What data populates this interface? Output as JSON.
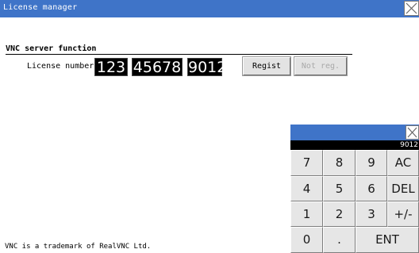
{
  "window": {
    "title": "License manager",
    "close_icon": "close-icon"
  },
  "section": {
    "title": "VNC server function"
  },
  "license": {
    "label": "License number",
    "segments": [
      "123",
      "45678",
      "9012"
    ]
  },
  "buttons": {
    "regist": "Regist",
    "not_reg": "Not reg."
  },
  "footer": {
    "trademark": "VNC is a trademark of RealVNC Ltd."
  },
  "keypad": {
    "display": "9012",
    "close_icon": "close-icon",
    "keys": [
      "7",
      "8",
      "9",
      "AC",
      "4",
      "5",
      "6",
      "DEL",
      "1",
      "2",
      "3",
      "+/-",
      "0",
      ".",
      "ENT"
    ]
  },
  "colors": {
    "title_bar": "#3f74c8",
    "field_bg": "#000000",
    "field_text": "#ffffff",
    "disabled_text": "#a9a9a9"
  }
}
